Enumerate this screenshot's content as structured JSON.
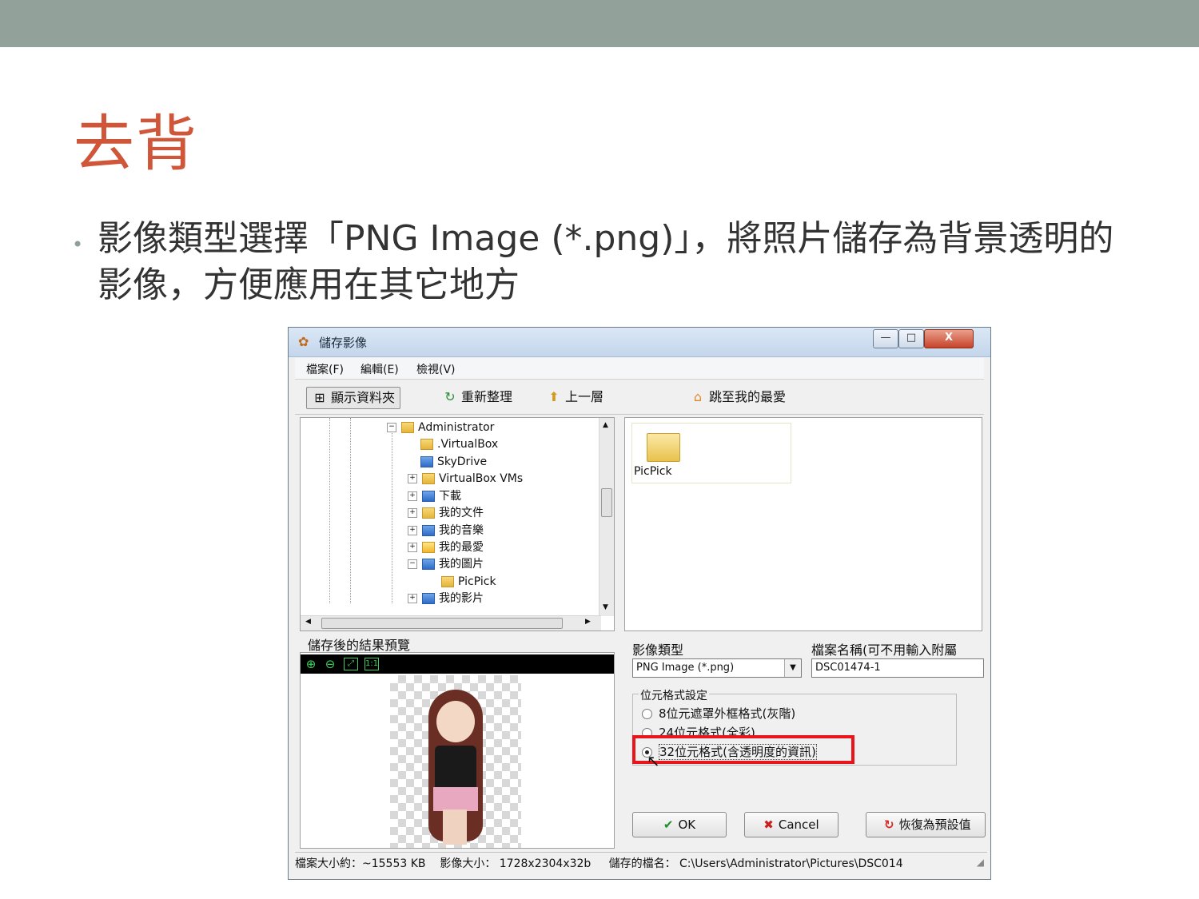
{
  "slide": {
    "title": "去背",
    "bullet": "影像類型選擇「PNG Image (*.png)」，將照片儲存為背景透明的影像，方便應用在其它地方"
  },
  "window": {
    "title": "儲存影像",
    "controls": {
      "minimize": "—",
      "maximize": "□",
      "close": "X"
    }
  },
  "menu": {
    "items": [
      "檔案(F)",
      "編輯(E)",
      "檢視(V)"
    ]
  },
  "toolbar": {
    "show_folders": "顯示資料夾",
    "refresh": "重新整理",
    "up_level": "上一層",
    "go_favorites": "跳至我的最愛"
  },
  "tree": {
    "items": [
      {
        "label": "Administrator",
        "expander": "−",
        "icon": "folder-icon"
      },
      {
        "label": ".VirtualBox",
        "expander": "",
        "icon": "folder-icon"
      },
      {
        "label": "SkyDrive",
        "expander": "",
        "icon": "cloud-icon"
      },
      {
        "label": "VirtualBox VMs",
        "expander": "+",
        "icon": "folder-icon"
      },
      {
        "label": "下載",
        "expander": "+",
        "icon": "download-folder-icon"
      },
      {
        "label": "我的文件",
        "expander": "+",
        "icon": "documents-folder-icon"
      },
      {
        "label": "我的音樂",
        "expander": "+",
        "icon": "music-folder-icon"
      },
      {
        "label": "我的最愛",
        "expander": "+",
        "icon": "favorites-folder-icon"
      },
      {
        "label": "我的圖片",
        "expander": "−",
        "icon": "pictures-folder-icon"
      },
      {
        "label": "PicPick",
        "expander": "",
        "icon": "folder-icon"
      },
      {
        "label": "我的影片",
        "expander": "+",
        "icon": "videos-folder-icon"
      }
    ]
  },
  "folder_view": {
    "items": [
      {
        "name": "PicPick",
        "icon": "folder-icon"
      }
    ]
  },
  "preview": {
    "label": "儲存後的結果預覽"
  },
  "form": {
    "image_type_label": "影像類型",
    "image_type_value": "PNG Image (*.png)",
    "filename_label": "檔案名稱(可不用輸入附屬",
    "filename_value": "DSC01474-1",
    "bit_group_label": "位元格式設定",
    "radios": [
      {
        "label": "8位元遮罩外框格式(灰階)",
        "selected": false
      },
      {
        "label": "24位元格式(全彩)",
        "selected": false
      },
      {
        "label": "32位元格式(含透明度的資訊)",
        "selected": true
      }
    ],
    "highlight_color": "#e8161a"
  },
  "buttons": {
    "ok": "OK",
    "cancel": "Cancel",
    "restore": "恢復為預設值"
  },
  "status": {
    "file_size": "檔案大小約：~15553 KB",
    "image_size": "影像大小： 1728x2304x32b",
    "saved_name": "儲存的檔名： C:\\Users\\Administrator\\Pictures\\DSC014"
  },
  "colors": {
    "topbar": "#92a199",
    "title": "#d0563a",
    "text": "#333333"
  }
}
